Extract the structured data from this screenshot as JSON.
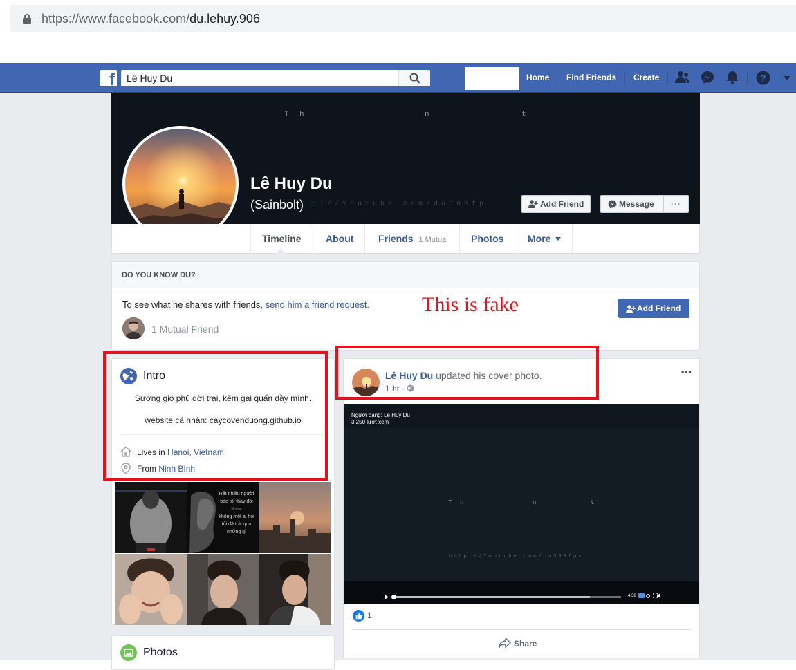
{
  "browser": {
    "url_scheme_host": "https://www.facebook.com/",
    "url_path": "du.lehuy.906"
  },
  "topbar": {
    "logo": "f",
    "search_value": "Lê Huy Du",
    "nav": [
      "Home",
      "Find Friends",
      "Create"
    ],
    "icons": [
      "friends-icon",
      "messenger-icon",
      "notifications-icon",
      "help-icon",
      "caret-down-icon"
    ]
  },
  "cover": {
    "overlay_chars": [
      "T",
      "h",
      "n",
      "t"
    ],
    "watermark": "p://Youtube.com/du360fp"
  },
  "profile": {
    "name": "Lê Huy Du",
    "alternate_name": "(Sainbolt)",
    "add_friend": "Add Friend",
    "message": "Message",
    "more_dots": "···"
  },
  "tabs": [
    {
      "label": "Timeline"
    },
    {
      "label": "About"
    },
    {
      "label": "Friends",
      "sub": "1 Mutual"
    },
    {
      "label": "Photos"
    },
    {
      "label": "More"
    }
  ],
  "do_you_know": {
    "title": "DO YOU KNOW DU?",
    "text_prefix": "To see what he shares with friends, ",
    "text_link": "send him a friend request.",
    "mutual": "1 Mutual Friend",
    "add_friend": "Add Friend"
  },
  "annotation": "This is fake",
  "intro": {
    "title": "Intro",
    "bio": "Sương gió phủ đời trai, kẽm gai quấn đầy mình.",
    "website": "website cá nhân: caycovenduong.github.io",
    "lives_prefix": "Lives in ",
    "lives_city": "Hanoi",
    "lives_country": "Vietnam",
    "from_prefix": "From ",
    "from_place": "Ninh Bình",
    "photo_captions": {
      "p2": [
        "Rất nhiều người",
        "bảo tôi thay đổi",
        "Nhưng",
        "không một ai hỏi",
        "tôi đã trải qua",
        "những gì"
      ]
    }
  },
  "photos_card": {
    "title": "Photos"
  },
  "post": {
    "author": "Lê Huy Du",
    "action": "updated his cover photo.",
    "time": "1 hr",
    "video_poster": "Người đăng: Lê Huy Du",
    "video_views": "3.250 lượt xem",
    "video_chars": [
      "T",
      "h",
      "n",
      "t"
    ],
    "video_watermark": "http://Youtube.com/du360fps",
    "video_time": "4:38",
    "likes": "1",
    "share": "Share",
    "menu": "•••"
  },
  "colors": {
    "fb_blue": "#4267b2",
    "link": "#385898",
    "annotation_red": "#e4121f",
    "page_bg": "#e9ebee"
  }
}
